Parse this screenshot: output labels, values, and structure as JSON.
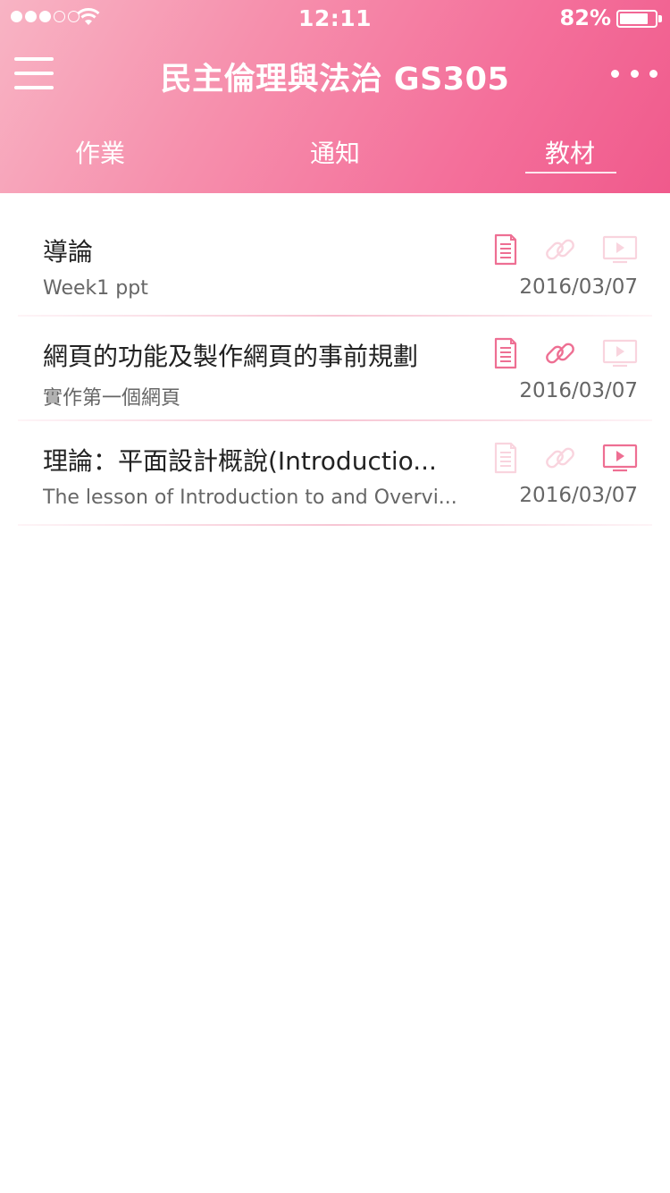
{
  "status_bar": {
    "time": "12:11",
    "battery_percent": "82%",
    "battery_level": 0.82
  },
  "header": {
    "title": "民主倫理與法治 GS305",
    "menu_icon": "hamburger-menu-icon",
    "more_icon": "more-dots-icon"
  },
  "tabs": [
    {
      "label": "作業",
      "selected": false
    },
    {
      "label": "通知",
      "selected": false
    },
    {
      "label": "教材",
      "selected": true
    }
  ],
  "colors": {
    "accent": "#f05a8c",
    "icon_active": "#ee6f93",
    "icon_inactive": "#f9d4de"
  },
  "materials": [
    {
      "title": "導論",
      "subtitle": "Week1 ppt",
      "date": "2016/03/07",
      "has_document": true,
      "has_link": false,
      "has_video": false
    },
    {
      "title": "網頁的功能及製作網頁的事前規劃",
      "subtitle": "實作第一個網頁",
      "date": "2016/03/07",
      "has_document": true,
      "has_link": true,
      "has_video": false
    },
    {
      "title": "理論：平面設計概說(Introductio...",
      "subtitle": "The lesson of Introduction to and Overvi...",
      "date": "2016/03/07",
      "has_document": false,
      "has_link": false,
      "has_video": true
    }
  ]
}
